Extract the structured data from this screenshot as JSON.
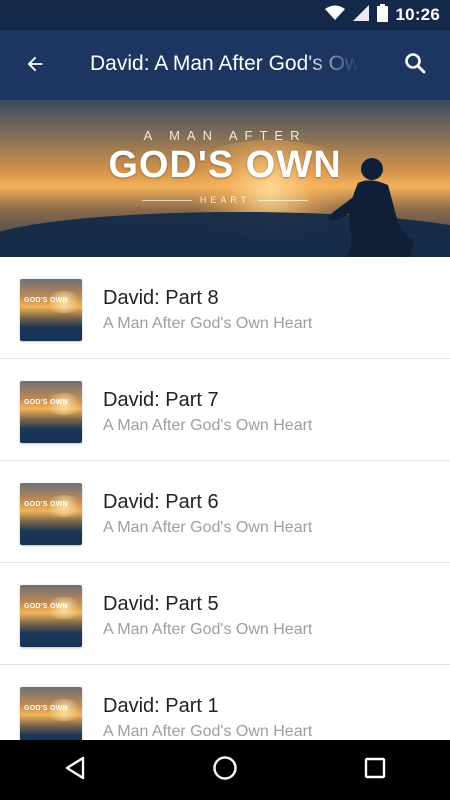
{
  "status_bar": {
    "time": "10:26",
    "icons": [
      "wifi-icon",
      "signal-icon",
      "battery-icon"
    ]
  },
  "app_bar": {
    "title": "David: A Man After God's Own Heart",
    "back_icon": "arrow-left-icon",
    "search_icon": "search-icon"
  },
  "banner": {
    "line1": "A MAN AFTER",
    "line2": "GOD'S OWN",
    "line3": "HEART"
  },
  "episodes": [
    {
      "title": "David: Part 8",
      "subtitle": "A Man After God's Own Heart",
      "thumb_label": "GOD'S OWN"
    },
    {
      "title": "David: Part 7",
      "subtitle": "A Man After God's Own Heart",
      "thumb_label": "GOD'S OWN"
    },
    {
      "title": "David: Part 6",
      "subtitle": "A Man After God's Own Heart",
      "thumb_label": "GOD'S OWN"
    },
    {
      "title": "David: Part 5",
      "subtitle": "A Man After God's Own Heart",
      "thumb_label": "GOD'S OWN"
    },
    {
      "title": "David: Part 1",
      "subtitle": "A Man After God's Own Heart",
      "thumb_label": "GOD'S OWN"
    }
  ],
  "nav_bar": {
    "buttons": [
      "back-triangle-icon",
      "home-circle-icon",
      "recents-square-icon"
    ]
  },
  "colors": {
    "status_bar": "#142849",
    "app_bar": "#1c3561",
    "title_text": "#222222",
    "subtitle_text": "#9e9e9e"
  }
}
